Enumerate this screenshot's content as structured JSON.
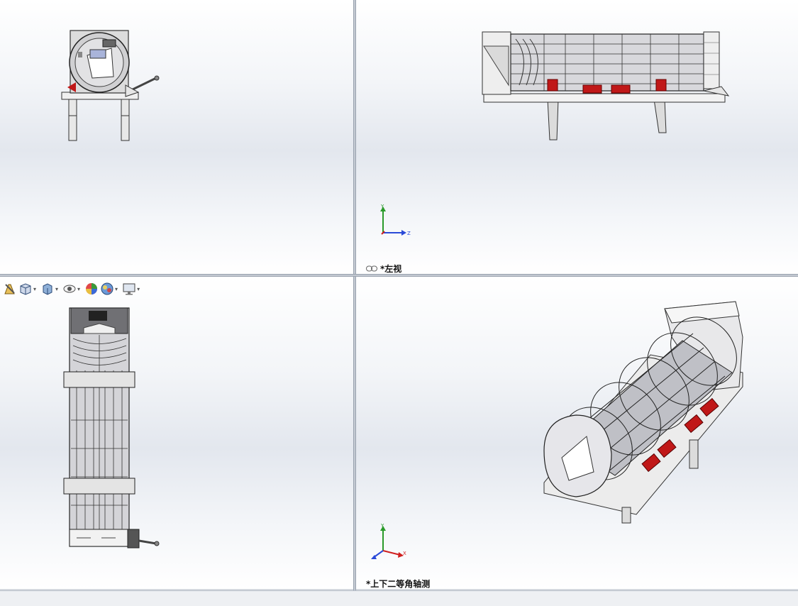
{
  "viewports": {
    "top_left": {
      "label": ""
    },
    "top_right": {
      "label": "*左视",
      "triad": {
        "y": "Y",
        "z": "Z"
      }
    },
    "bottom_left": {
      "label": ""
    },
    "bottom_right": {
      "label": "*上下二等角轴测",
      "triad": {
        "y": "Y",
        "x": "X"
      }
    }
  },
  "hud_toolbar": {
    "icons": [
      "edit-appearance-icon",
      "view-orientation-icon",
      "display-style-icon",
      "hide-show-icon",
      "appearance-icon",
      "scene-icon",
      "view-settings-icon"
    ]
  },
  "status_bar": {
    "text": ""
  },
  "colors": {
    "viewport_top": "#ffffff",
    "viewport_mid": "#e3e7ee",
    "model_line": "#3a3a3a",
    "motor_red": "#c01818",
    "axis_y": "#2a9a2a",
    "axis_z": "#2a4ad8",
    "axis_x": "#d02020"
  }
}
